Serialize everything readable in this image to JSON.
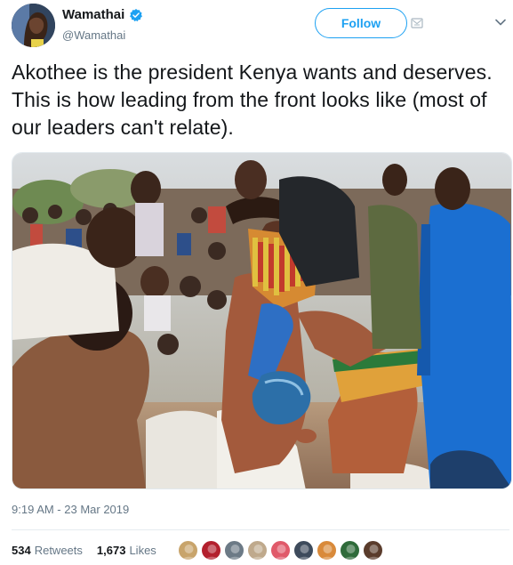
{
  "user": {
    "display_name": "Wamathai",
    "handle": "@Wamathai",
    "verified": true
  },
  "actions": {
    "follow_label": "Follow"
  },
  "tweet": {
    "text": "Akothee is the president Kenya wants and deserves. This is how leading from the front looks like (most of our leaders can't relate).",
    "timestamp": "9:19 AM - 23 Mar 2019"
  },
  "stats": {
    "retweets_count": "534",
    "retweets_label": "Retweets",
    "likes_count": "1,673",
    "likes_label": "Likes"
  },
  "liker_avatars": [
    {
      "color": "#c8a46b"
    },
    {
      "color": "#b3202d"
    },
    {
      "color": "#6c7a86"
    },
    {
      "color": "#bfa98c"
    },
    {
      "color": "#e05a6a"
    },
    {
      "color": "#3e4b5c"
    },
    {
      "color": "#d98a3a"
    },
    {
      "color": "#2f6b3a"
    },
    {
      "color": "#5a3c2c"
    }
  ],
  "colors": {
    "accent": "#1da1f2",
    "text_primary": "#14171a",
    "text_secondary": "#657786"
  }
}
